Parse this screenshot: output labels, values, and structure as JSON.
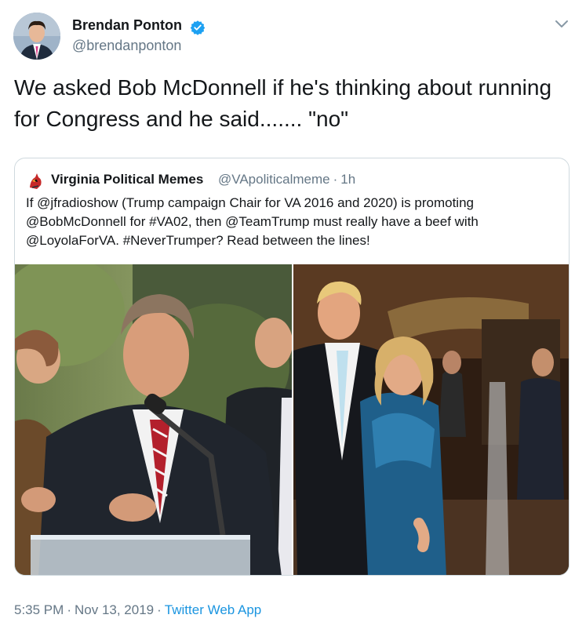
{
  "author": {
    "display_name": "Brendan Ponton",
    "handle": "@brendanponton",
    "verified": true
  },
  "tweet": {
    "text": "We asked Bob McDonnell if he's thinking about running for Congress and he said....... \"no\""
  },
  "quoted_tweet": {
    "display_name": "Virginia Political Memes",
    "handle": "@VApoliticalmeme",
    "separator": "·",
    "time_ago": "1h",
    "text": "If @jfradioshow (Trump campaign Chair for VA 2016 and 2020) is promoting @BobMcDonnell for #VA02, then @TeamTrump must really have a beef with @LoyolaForVA. #NeverTrumper? Read between the lines!"
  },
  "meta": {
    "time": "5:35 PM",
    "separator": "·",
    "date": "Nov 13, 2019",
    "source": "Twitter Web App"
  },
  "colors": {
    "verified": "#1da1f2",
    "link": "#1b95e0",
    "secondary_text": "#657786",
    "border": "#cfd9de"
  },
  "icons": {
    "verified": "verified-badge-icon",
    "caret": "chevron-down-icon"
  }
}
